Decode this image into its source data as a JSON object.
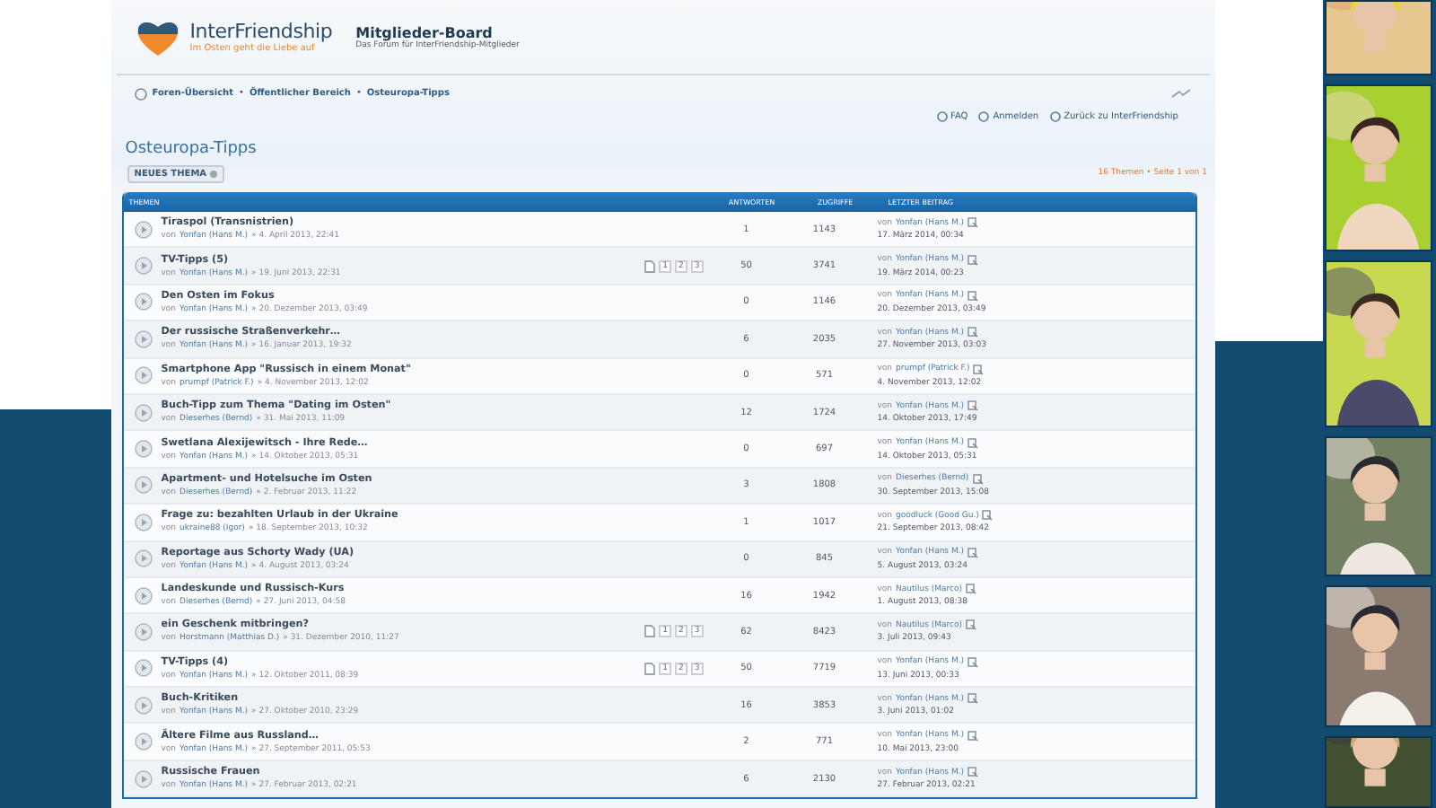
{
  "brand": {
    "name": "InterFriendship",
    "slogan": "Im Osten geht die Liebe auf",
    "board": "Mitglieder-Board",
    "board_sub": "Das Forum für InterFriendship-Mitglieder"
  },
  "breadcrumb": [
    "Foren-Übersicht",
    "Öffentlicher Bereich",
    "Osteuropa-Tipps"
  ],
  "breadcrumb_sep": "•",
  "links": [
    "FAQ",
    "Anmelden",
    "Zurück zu InterFriendship"
  ],
  "forum_title": "Osteuropa-Tipps",
  "new_topic_button": "NEUES THEMA",
  "pagination": "16 Themen • Seite 1 von 1",
  "columns": [
    "THEMEN",
    "ANTWORTEN",
    "ZUGRIFFE",
    "LETZTER BEITRAG"
  ],
  "topics": [
    {
      "title": "Tiraspol (Transnistrien)",
      "by": "von",
      "author": "Yonfan (Hans M.)",
      "posted": "» 4. April 2013, 22:41",
      "replies": "1",
      "views": "1143",
      "last_by": "von",
      "last_author": "Yonfan (Hans M.)",
      "last_date": "17. März 2014, 00:34"
    },
    {
      "title": "TV-Tipps (5)",
      "by": "von",
      "author": "Yonfan (Hans M.)",
      "posted": "» 19. Juni 2013, 22:31",
      "pages": [
        "1",
        "2",
        "3"
      ],
      "replies": "50",
      "views": "3741",
      "last_by": "von",
      "last_author": "Yonfan (Hans M.)",
      "last_date": "19. März 2014, 00:23"
    },
    {
      "title": "Den Osten im Fokus",
      "by": "von",
      "author": "Yonfan (Hans M.)",
      "posted": "» 20. Dezember 2013, 03:49",
      "replies": "0",
      "views": "1146",
      "last_by": "von",
      "last_author": "Yonfan (Hans M.)",
      "last_date": "20. Dezember 2013, 03:49"
    },
    {
      "title": "Der russische Straßenverkehr…",
      "by": "von",
      "author": "Yonfan (Hans M.)",
      "posted": "» 16. Januar 2013, 19:32",
      "replies": "6",
      "views": "2035",
      "last_by": "von",
      "last_author": "Yonfan (Hans M.)",
      "last_date": "27. November 2013, 03:03"
    },
    {
      "title": "Smartphone App \"Russisch in einem Monat\"",
      "by": "von",
      "author": "prumpf (Patrick F.)",
      "posted": "» 4. November 2013, 12:02",
      "replies": "0",
      "views": "571",
      "last_by": "von",
      "last_author": "prumpf (Patrick F.)",
      "last_date": "4. November 2013, 12:02"
    },
    {
      "title": "Buch-Tipp zum Thema \"Dating im Osten\"",
      "by": "von",
      "author": "Dieserhes (Bernd)",
      "posted": "» 31. Mai 2013, 11:09",
      "replies": "12",
      "views": "1724",
      "last_by": "von",
      "last_author": "Yonfan (Hans M.)",
      "last_date": "14. Oktober 2013, 17:49"
    },
    {
      "title": "Swetlana Alexijewitsch - Ihre Rede…",
      "by": "von",
      "author": "Yonfan (Hans M.)",
      "posted": "» 14. Oktober 2013, 05:31",
      "replies": "0",
      "views": "697",
      "last_by": "von",
      "last_author": "Yonfan (Hans M.)",
      "last_date": "14. Oktober 2013, 05:31"
    },
    {
      "title": "Apartment- und Hotelsuche im Osten",
      "by": "von",
      "author": "Dieserhes (Bernd)",
      "posted": "» 2. Februar 2013, 11:22",
      "replies": "3",
      "views": "1808",
      "last_by": "von",
      "last_author": "Dieserhes (Bernd)",
      "last_date": "30. September 2013, 15:08"
    },
    {
      "title": "Frage zu: bezahlten Urlaub in der Ukraine",
      "by": "von",
      "author": "ukraine88 (Igor)",
      "posted": "» 18. September 2013, 10:32",
      "replies": "1",
      "views": "1017",
      "last_by": "von",
      "last_author": "goodluck (Good Gu.)",
      "last_date": "21. September 2013, 08:42"
    },
    {
      "title": "Reportage aus Schorty Wady (UA)",
      "by": "von",
      "author": "Yonfan (Hans M.)",
      "posted": "» 4. August 2013, 03:24",
      "replies": "0",
      "views": "845",
      "last_by": "von",
      "last_author": "Yonfan (Hans M.)",
      "last_date": "5. August 2013, 03:24"
    },
    {
      "title": "Landeskunde und Russisch-Kurs",
      "by": "von",
      "author": "Dieserhes (Bernd)",
      "posted": "» 27. Juni 2013, 04:58",
      "replies": "16",
      "views": "1942",
      "last_by": "von",
      "last_author": "Nautilus (Marco)",
      "last_date": "1. August 2013, 08:38"
    },
    {
      "title": "ein Geschenk mitbringen?",
      "by": "von",
      "author": "Horstmann (Matthias D.)",
      "posted": "» 31. Dezember 2010, 11:27",
      "pages": [
        "1",
        "2",
        "3"
      ],
      "replies": "62",
      "views": "8423",
      "last_by": "von",
      "last_author": "Nautilus (Marco)",
      "last_date": "3. Juli 2013, 09:43"
    },
    {
      "title": "TV-Tipps (4)",
      "by": "von",
      "author": "Yonfan (Hans M.)",
      "posted": "» 12. Oktober 2011, 08:39",
      "pages": [
        "1",
        "2",
        "3"
      ],
      "replies": "50",
      "views": "7719",
      "last_by": "von",
      "last_author": "Yonfan (Hans M.)",
      "last_date": "13. Juni 2013, 00:33"
    },
    {
      "title": "Buch-Kritiken",
      "by": "von",
      "author": "Yonfan (Hans M.)",
      "posted": "» 27. Oktober 2010, 23:29",
      "replies": "16",
      "views": "3853",
      "last_by": "von",
      "last_author": "Yonfan (Hans M.)",
      "last_date": "3. Juni 2013, 01:02"
    },
    {
      "title": "Ältere Filme aus Russland…",
      "by": "von",
      "author": "Yonfan (Hans M.)",
      "posted": "» 27. September 2011, 05:53",
      "replies": "2",
      "views": "771",
      "last_by": "von",
      "last_author": "Yonfan (Hans M.)",
      "last_date": "10. Mai 2013, 23:00"
    },
    {
      "title": "Russische Frauen",
      "by": "von",
      "author": "Yonfan (Hans M.)",
      "posted": "» 27. Februar 2013, 02:21",
      "replies": "6",
      "views": "2130",
      "last_by": "von",
      "last_author": "Yonfan (Hans M.)",
      "last_date": "27. Februar 2013, 02:21"
    }
  ],
  "photos": [
    {
      "kind": "picture"
    },
    {
      "kind": "picture"
    },
    {
      "kind": "picture"
    },
    {
      "kind": "picture"
    },
    {
      "kind": "picture"
    },
    {
      "kind": "picture"
    }
  ]
}
